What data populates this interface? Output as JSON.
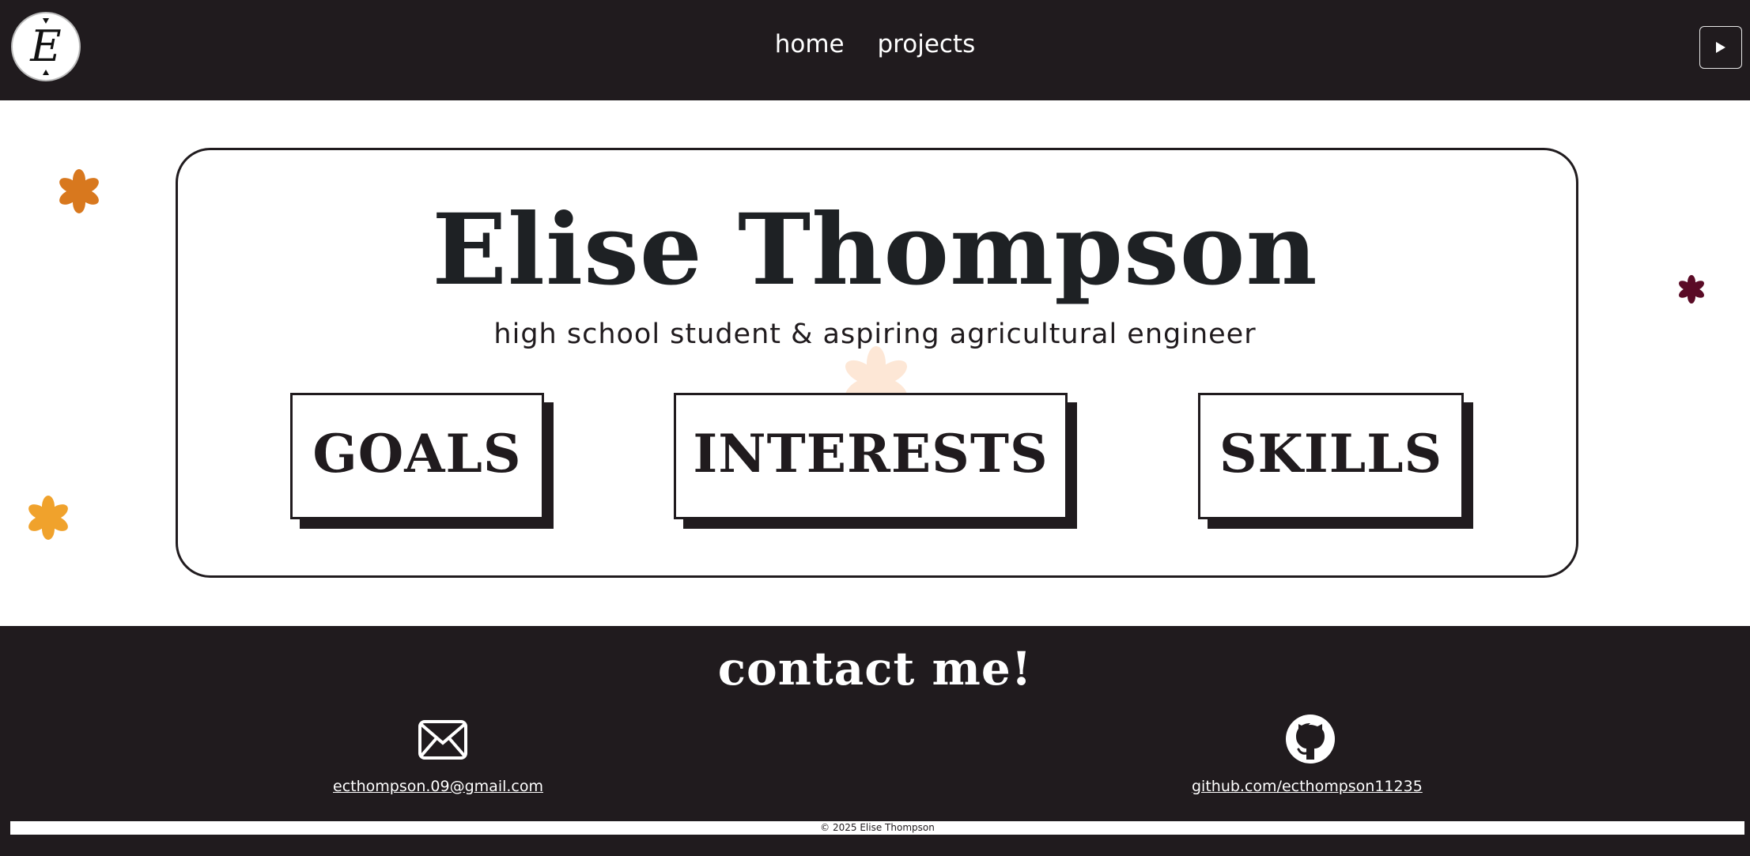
{
  "header": {
    "logo_icon": "monogram-e-icon",
    "nav": [
      {
        "label": "home"
      },
      {
        "label": "projects"
      }
    ],
    "play_icon": "play-icon"
  },
  "hero": {
    "name": "Elise Thompson",
    "tagline": "high school student & aspiring agricultural engineer",
    "buttons": [
      {
        "label": "GOALS"
      },
      {
        "label": "INTERESTS"
      },
      {
        "label": "SKILLS"
      }
    ],
    "flower_colors": [
      "#d8781e",
      "#f0a22c",
      "#5a0b26",
      "#fde7d6"
    ]
  },
  "contact": {
    "title": "contact me!",
    "email_icon": "envelope-icon",
    "email": "ecthompson.09@gmail.com",
    "github_icon": "github-icon",
    "github": "github.com/ecthompson11235"
  },
  "footer": {
    "copyright": "© 2025 Elise Thompson"
  },
  "colors": {
    "dark": "#201b1e",
    "text_dark": "#1e2124",
    "light": "#ffffff"
  }
}
